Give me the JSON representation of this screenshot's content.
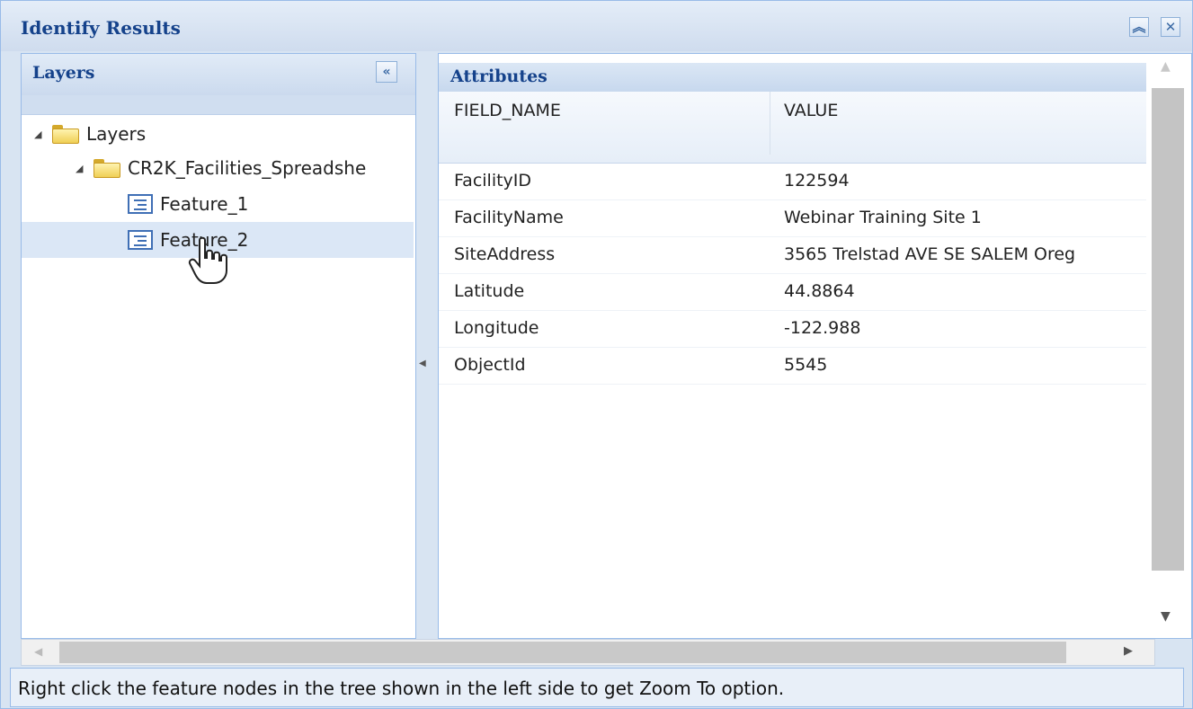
{
  "window": {
    "title": "Identify Results"
  },
  "left_panel": {
    "title": "Layers",
    "tree": {
      "root": "Layers",
      "layer": "CR2K_Facilities_Spreadshe",
      "features": [
        "Feature_1",
        "Feature_2"
      ],
      "selected_feature": "Feature_2"
    }
  },
  "attributes": {
    "title": "Attributes",
    "columns": [
      "FIELD_NAME",
      "VALUE"
    ],
    "rows": [
      {
        "field": "FacilityID",
        "value": "122594"
      },
      {
        "field": "FacilityName",
        "value": "Webinar Training Site 1"
      },
      {
        "field": "SiteAddress",
        "value": "3565 Trelstad AVE SE SALEM Oreg"
      },
      {
        "field": "Latitude",
        "value": "44.8864"
      },
      {
        "field": "Longitude",
        "value": "-122.988"
      },
      {
        "field": "ObjectId",
        "value": "5545"
      }
    ]
  },
  "status": {
    "text": "Right click the feature nodes in the tree shown in the left side to get Zoom To option."
  },
  "icons": {
    "collapse_window": "double-chevron-up-icon",
    "close": "close-icon",
    "collapse_panel": "double-chevron-left-icon",
    "folder": "folder-icon",
    "feature": "feature-table-icon",
    "cursor": "hand-pointer-icon"
  },
  "colors": {
    "header_text": "#15428b",
    "panel_border": "#99bbe8",
    "selected_row": "#dbe7f6"
  }
}
